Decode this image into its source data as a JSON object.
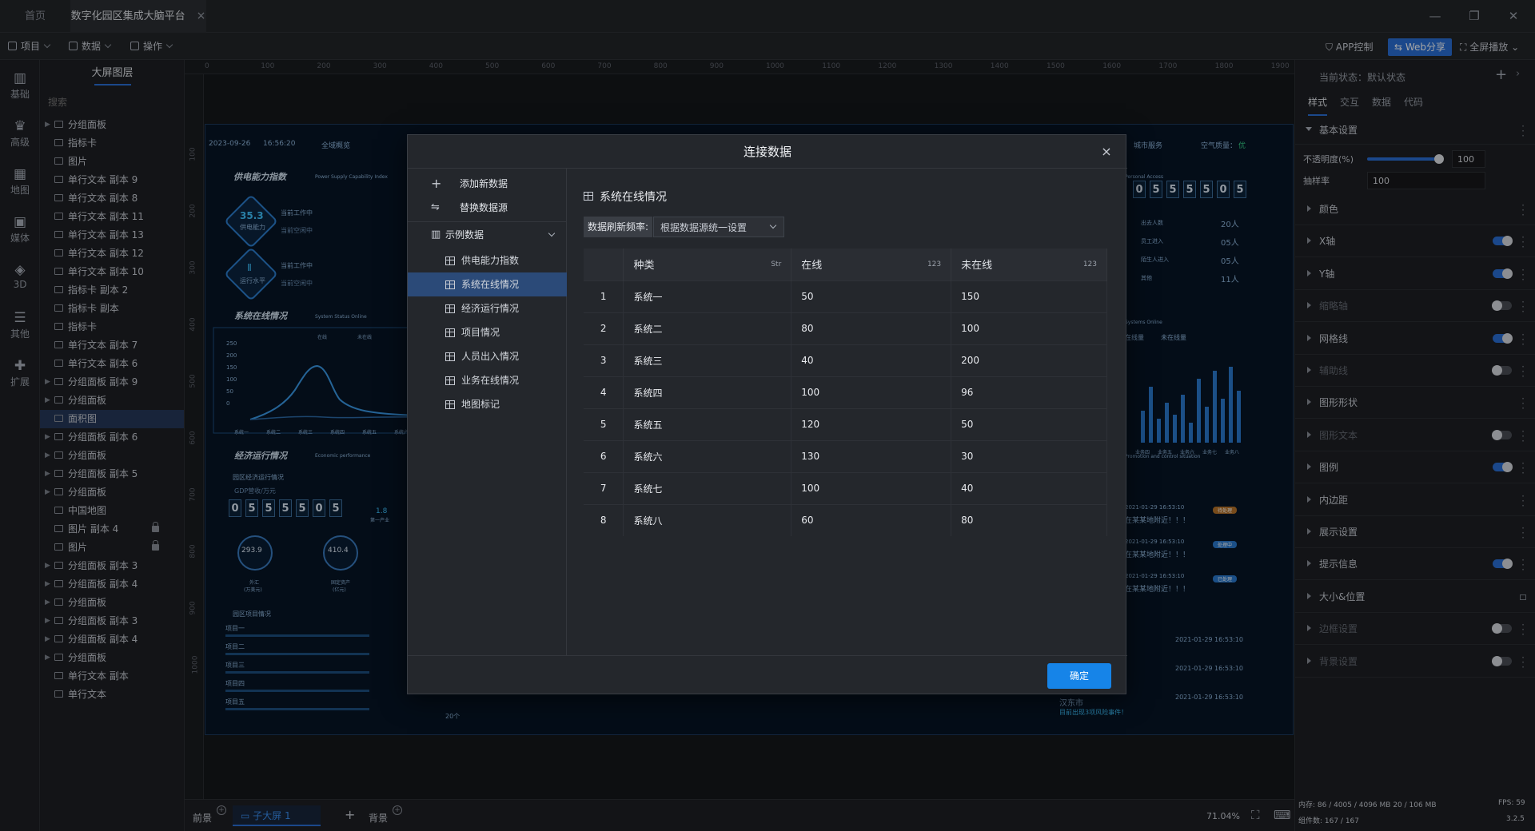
{
  "tabs": [
    {
      "label": "首页",
      "active": false
    },
    {
      "label": "数字化园区集成大脑平台",
      "active": true,
      "close": "×"
    }
  ],
  "window_controls": {
    "minimize": "—",
    "restore": "❐",
    "close": "✕"
  },
  "toolbar": {
    "menus": [
      "项目",
      "数据",
      "操作"
    ],
    "app_control": "APP控制",
    "web_share": "Web分享",
    "fullscreen": "全屏播放"
  },
  "left_rail": [
    "基础",
    "高级",
    "地图",
    "媒体",
    "3D",
    "其他",
    "扩展"
  ],
  "layer_panel": {
    "tab": "大屏图层",
    "search_placeholder": "搜索",
    "selected_index": 16,
    "items": [
      {
        "name": "分组面板",
        "group": true
      },
      {
        "name": "指标卡"
      },
      {
        "name": "图片"
      },
      {
        "name": "单行文本 副本 9"
      },
      {
        "name": "单行文本 副本 8"
      },
      {
        "name": "单行文本 副本 11"
      },
      {
        "name": "单行文本 副本 13"
      },
      {
        "name": "单行文本 副本 12"
      },
      {
        "name": "单行文本 副本 10"
      },
      {
        "name": "指标卡 副本 2"
      },
      {
        "name": "指标卡 副本"
      },
      {
        "name": "指标卡"
      },
      {
        "name": "单行文本 副本 7"
      },
      {
        "name": "单行文本 副本 6"
      },
      {
        "name": "分组面板 副本 9",
        "group": true
      },
      {
        "name": "分组面板",
        "group": true
      },
      {
        "name": "面积图"
      },
      {
        "name": "分组面板 副本 6",
        "group": true
      },
      {
        "name": "分组面板",
        "group": true
      },
      {
        "name": "分组面板 副本 5",
        "group": true
      },
      {
        "name": "分组面板",
        "group": true
      },
      {
        "name": "中国地图"
      },
      {
        "name": "图片 副本 4",
        "locked": true
      },
      {
        "name": "图片",
        "locked": true
      },
      {
        "name": "分组面板 副本 3",
        "group": true
      },
      {
        "name": "分组面板 副本 4",
        "group": true
      },
      {
        "name": "分组面板",
        "group": true
      },
      {
        "name": "分组面板 副本 3",
        "group": true
      },
      {
        "name": "分组面板 副本 4",
        "group": true
      },
      {
        "name": "分组面板",
        "group": true
      },
      {
        "name": "单行文本 副本"
      },
      {
        "name": "单行文本"
      }
    ]
  },
  "rulers": {
    "h": [
      "0",
      "100",
      "200",
      "300",
      "400",
      "500",
      "600",
      "700",
      "800",
      "900",
      "1000",
      "1100",
      "1200",
      "1300",
      "1400",
      "1500",
      "1600",
      "1700",
      "1800",
      "1900"
    ],
    "v": [
      "100",
      "200",
      "300",
      "400",
      "500",
      "600",
      "700",
      "800",
      "900",
      "1000"
    ]
  },
  "screen": {
    "date": "2023-09-26",
    "time": "16:56:20",
    "nav_left": "全域概览",
    "nav_right": "城市服务",
    "air_label": "空气质量：",
    "air_value": "优",
    "supply_title": "供电能力指数",
    "supply_sub": "Power Supply Capability Index",
    "supply_value": "35.3",
    "supply_label": "供电能力",
    "running_value": "Ⅱ",
    "running_label": "运行水平",
    "working": "当前工作中",
    "idle": "当前空闲中",
    "working2": "当前工作中",
    "idle2": "当前空闲中",
    "system_title": "系统在线情况",
    "system_sub": "System Status Online",
    "legend_online": "在线",
    "legend_offline": "未在线",
    "y_ticks": [
      "250",
      "200",
      "150",
      "100",
      "50",
      "0"
    ],
    "x_ticks": [
      "系统一",
      "系统二",
      "系统三",
      "系统四",
      "系统五",
      "系统六"
    ],
    "econ_title": "经济运行情况",
    "econ_sub": "Economic performance",
    "park_econ": "园区经济运行情况",
    "gdp_label": "GDP营收/万元",
    "gdp_digits": [
      "0",
      "5",
      "5",
      "5",
      "5",
      "0",
      "5"
    ],
    "gdp_side_value": "1.8",
    "gdp_side_label": "第一产业",
    "ring1_value": "293.9",
    "ring1_label": "外汇",
    "ring1_unit": "(万美元)",
    "ring2_value": "410.4",
    "ring2_label": "固定资产",
    "ring2_unit": "(亿元)",
    "project_title": "园区项目情况",
    "projects": [
      "项目一",
      "项目二",
      "项目三",
      "项目四",
      "项目五"
    ],
    "project_count": "20个",
    "right_access": "Personal Access",
    "right_digits": [
      "0",
      "5",
      "5",
      "5",
      "5",
      "0",
      "5"
    ],
    "access_rows": [
      {
        "label": "出去人数",
        "value": "20人"
      },
      {
        "label": "员工进入",
        "value": "05人"
      },
      {
        "label": "陌生人进入",
        "value": "05人"
      },
      {
        "label": "其他",
        "value": "11人"
      }
    ],
    "right_online": "Systems Online",
    "right_legend_online": "在线量",
    "right_legend_offline": "未在线量",
    "right_x_ticks": [
      "业务四",
      "业务五",
      "业务六",
      "业务七",
      "业务八"
    ],
    "alerts_title": "Promotion and control situation",
    "alerts": [
      {
        "time": "2021-01-29 16:53:10",
        "text": "在某某地附近！！！",
        "badge": "待处理"
      },
      {
        "time": "2021-01-29 16:53:10",
        "text": "在某某地附近！！！",
        "badge": "处理中"
      },
      {
        "time": "2021-01-29 16:53:10",
        "text": "在某某地附近！！！",
        "badge": "已处理"
      }
    ],
    "logs": [
      "2021-01-29 16:53:10",
      "2021-01-29 16:53:10",
      "2021-01-29 16:53:10"
    ],
    "bottom_city": "汉东市",
    "bottom_event": "目前出现3项风险事件！"
  },
  "bottom_bar": {
    "foreground": "前景",
    "sub_screen": "子大屏 1",
    "add": "+",
    "background": "背景",
    "zoom": "71.04%"
  },
  "right_panel": {
    "state_label": "当前状态：",
    "state_value": "默认状态",
    "tabs": [
      "样式",
      "交互",
      "数据",
      "代码"
    ],
    "active_tab": 0,
    "section_basic": "基本设置",
    "opacity_label": "不透明度(%)",
    "opacity_value": "100",
    "opacity_fraction": 1.0,
    "sample_label": "抽样率",
    "sample_value": "100",
    "rows": [
      {
        "label": "颜色",
        "toggle": null,
        "dim": false
      },
      {
        "label": "X轴",
        "toggle": "on",
        "dim": false
      },
      {
        "label": "Y轴",
        "toggle": "on",
        "dim": false
      },
      {
        "label": "缩略轴",
        "toggle": "off",
        "dim": true
      },
      {
        "label": "网格线",
        "toggle": "on",
        "dim": false
      },
      {
        "label": "辅助线",
        "toggle": "off",
        "dim": true
      },
      {
        "label": "图形形状",
        "toggle": null,
        "dim": false
      },
      {
        "label": "图形文本",
        "toggle": "off",
        "dim": true
      },
      {
        "label": "图例",
        "toggle": "on",
        "dim": false
      },
      {
        "label": "内边距",
        "toggle": null,
        "dim": false
      },
      {
        "label": "展示设置",
        "toggle": null,
        "dim": false
      },
      {
        "label": "提示信息",
        "toggle": "on",
        "dim": false
      },
      {
        "label": "大小&位置",
        "toggle": null,
        "dim": false,
        "lock": true
      },
      {
        "label": "边框设置",
        "toggle": "off",
        "dim": true
      },
      {
        "label": "背景设置",
        "toggle": "off",
        "dim": true
      }
    ],
    "stats_memory": "内存: 86 / 4005 / 4096 MB  20 / 106 MB",
    "stats_fps": "FPS: 59",
    "stats_components": "组件数: 167 / 167",
    "version": "3.2.5"
  },
  "dialog": {
    "title": "连接数据",
    "close": "×",
    "add_new": "添加新数据",
    "replace": "替换数据源",
    "sample_group": "示例数据",
    "datasets": [
      "供电能力指数",
      "系统在线情况",
      "经济运行情况",
      "项目情况",
      "人员出入情况",
      "业务在线情况",
      "地图标记"
    ],
    "selected_dataset": 1,
    "table_title": "系统在线情况",
    "freq_label": "数据刷新频率:",
    "freq_value": "根据数据源统一设置",
    "columns": [
      {
        "name": "种类",
        "type": "Str"
      },
      {
        "name": "在线",
        "type": "123"
      },
      {
        "name": "未在线",
        "type": "123"
      }
    ],
    "rows": [
      {
        "idx": "1",
        "kind": "系统一",
        "online": "50",
        "offline": "150"
      },
      {
        "idx": "2",
        "kind": "系统二",
        "online": "80",
        "offline": "100"
      },
      {
        "idx": "3",
        "kind": "系统三",
        "online": "40",
        "offline": "200"
      },
      {
        "idx": "4",
        "kind": "系统四",
        "online": "100",
        "offline": "96"
      },
      {
        "idx": "5",
        "kind": "系统五",
        "online": "120",
        "offline": "50"
      },
      {
        "idx": "6",
        "kind": "系统六",
        "online": "130",
        "offline": "30"
      },
      {
        "idx": "7",
        "kind": "系统七",
        "online": "100",
        "offline": "40"
      },
      {
        "idx": "8",
        "kind": "系统八",
        "online": "60",
        "offline": "80"
      }
    ],
    "ok": "确定"
  },
  "colors": {
    "accent": "#1684e8",
    "panel": "#24272c",
    "selected": "#2b4a78",
    "screen_bg": "#071526"
  }
}
